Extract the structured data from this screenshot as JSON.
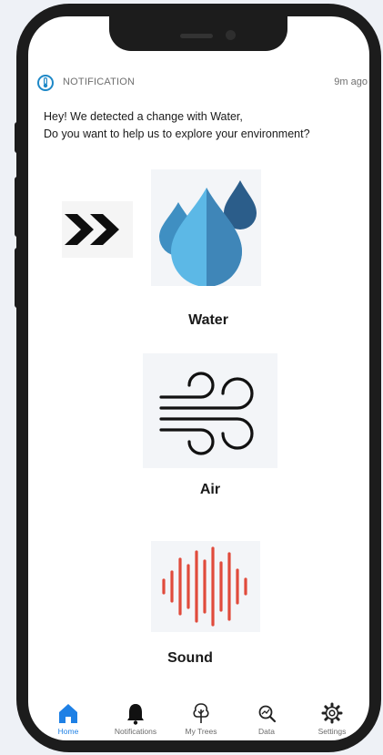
{
  "notification": {
    "header": "NOTIFICATION",
    "time": "9m ago",
    "message_line1": "Hey! We detected a change with Water,",
    "message_line2": "Do you want to help us to explore your environment?"
  },
  "categories": [
    {
      "name": "Water",
      "icon": "water-drops-icon",
      "highlighted": true
    },
    {
      "name": "Air",
      "icon": "wind-icon"
    },
    {
      "name": "Sound",
      "icon": "sound-wave-icon"
    }
  ],
  "tabs": [
    {
      "label": "Home",
      "icon": "home-icon",
      "active": true
    },
    {
      "label": "Notifications",
      "icon": "bell-icon"
    },
    {
      "label": "My Trees",
      "icon": "tree-icon"
    },
    {
      "label": "Data",
      "icon": "data-search-icon"
    },
    {
      "label": "Settings",
      "icon": "gear-icon"
    }
  ],
  "colors": {
    "accent": "#1e80e5",
    "water_light": "#5cb8e6",
    "water_mid": "#3f8fc2",
    "water_dark": "#2b5d8a",
    "sound": "#e04b3c"
  }
}
